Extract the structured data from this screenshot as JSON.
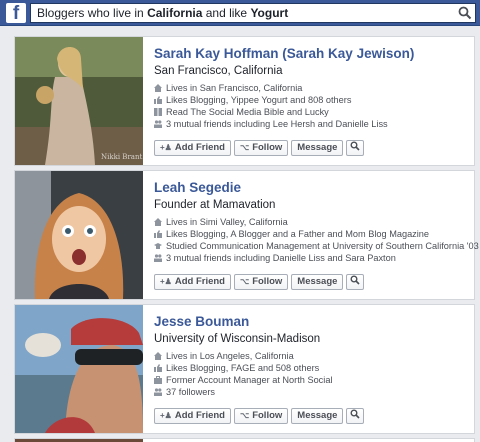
{
  "search": {
    "query_parts": [
      {
        "text": "Bloggers who live in ",
        "bold": false
      },
      {
        "text": "California",
        "bold": true
      },
      {
        "text": " and like ",
        "bold": false
      },
      {
        "text": "Yogurt",
        "bold": true
      }
    ]
  },
  "brand": {
    "logo": "f",
    "color": "#3b5998"
  },
  "buttons": {
    "add_friend": "Add Friend",
    "follow": "Follow",
    "message": "Message"
  },
  "results": [
    {
      "name": "Sarah Kay Hoffman (Sarah Kay Jewison)",
      "subtitle": "San Francisco, California",
      "photo_watermark": "Nikki Brant",
      "facts": [
        {
          "icon": "home-icon",
          "text": "Lives in San Francisco, California"
        },
        {
          "icon": "thumbs-up-icon",
          "text": "Likes Blogging, Yippee Yogurt and 808 others"
        },
        {
          "icon": "book-icon",
          "text": "Read The Social Media Bible and Lucky"
        },
        {
          "icon": "friends-icon",
          "text": "3 mutual friends including Lee Hersh and Danielle Liss"
        }
      ]
    },
    {
      "name": "Leah Segedie",
      "subtitle": "Founder at Mamavation",
      "facts": [
        {
          "icon": "home-icon",
          "text": "Lives in Simi Valley, California"
        },
        {
          "icon": "thumbs-up-icon",
          "text": "Likes Blogging, A Blogger and a Father and Mom Blog Magazine"
        },
        {
          "icon": "graduation-cap-icon",
          "text": "Studied Communication Management at University of Southern California '03"
        },
        {
          "icon": "friends-icon",
          "text": "3 mutual friends including Danielle Liss and Sara Paxton"
        }
      ]
    },
    {
      "name": "Jesse Bouman",
      "subtitle": "University of Wisconsin-Madison",
      "facts": [
        {
          "icon": "home-icon",
          "text": "Lives in Los Angeles, California"
        },
        {
          "icon": "thumbs-up-icon",
          "text": "Likes Blogging, FAGE and 508 others"
        },
        {
          "icon": "briefcase-icon",
          "text": "Former Account Manager at North Social"
        },
        {
          "icon": "followers-icon",
          "text": "37 followers"
        }
      ]
    }
  ]
}
